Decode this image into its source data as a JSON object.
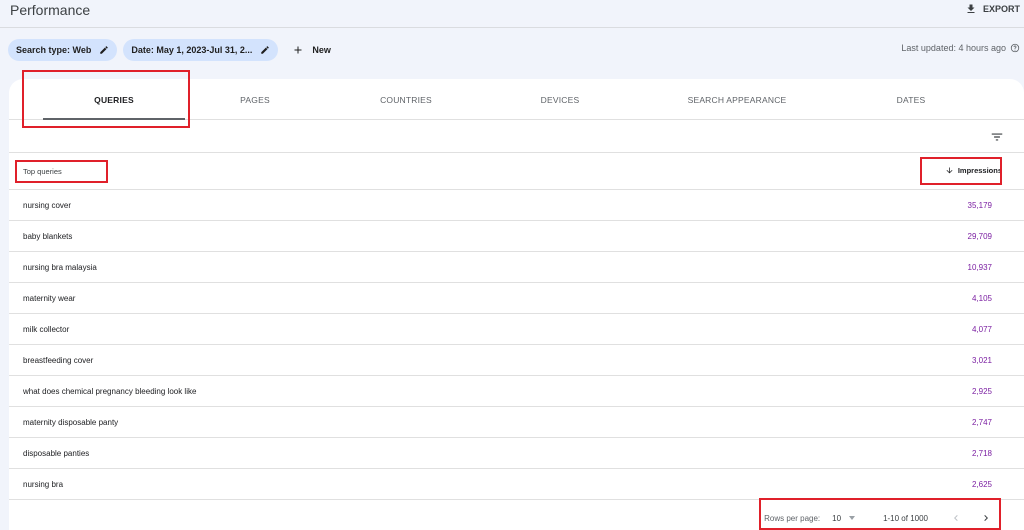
{
  "header": {
    "title": "Performance",
    "export_label": "EXPORT"
  },
  "filters": {
    "search_type": "Search type: Web",
    "date": "Date: May 1, 2023-Jul 31, 2...",
    "new_label": "New",
    "last_updated": "Last updated: 4 hours ago"
  },
  "tabs": [
    {
      "label": "QUERIES",
      "active": true
    },
    {
      "label": "PAGES"
    },
    {
      "label": "COUNTRIES"
    },
    {
      "label": "DEVICES"
    },
    {
      "label": "SEARCH APPEARANCE"
    },
    {
      "label": "DATES"
    }
  ],
  "table": {
    "query_header": "Top queries",
    "impressions_header": "Impressions",
    "rows": [
      {
        "query": "nursing cover",
        "impressions": "35,179"
      },
      {
        "query": "baby blankets",
        "impressions": "29,709"
      },
      {
        "query": "nursing bra malaysia",
        "impressions": "10,937"
      },
      {
        "query": "maternity wear",
        "impressions": "4,105"
      },
      {
        "query": "milk collector",
        "impressions": "4,077"
      },
      {
        "query": "breastfeeding cover",
        "impressions": "3,021"
      },
      {
        "query": "what does chemical pregnancy bleeding look like",
        "impressions": "2,925"
      },
      {
        "query": "maternity disposable panty",
        "impressions": "2,747"
      },
      {
        "query": "disposable panties",
        "impressions": "2,718"
      },
      {
        "query": "nursing bra",
        "impressions": "2,625"
      }
    ]
  },
  "pagination": {
    "rows_per_page_label": "Rows per page:",
    "rows_per_page_value": "10",
    "range": "1-10 of 1000"
  },
  "colors": {
    "accent_chip": "#d3e3fd",
    "impressions_value": "#7b1fa2",
    "highlight_box": "#e0202a"
  }
}
